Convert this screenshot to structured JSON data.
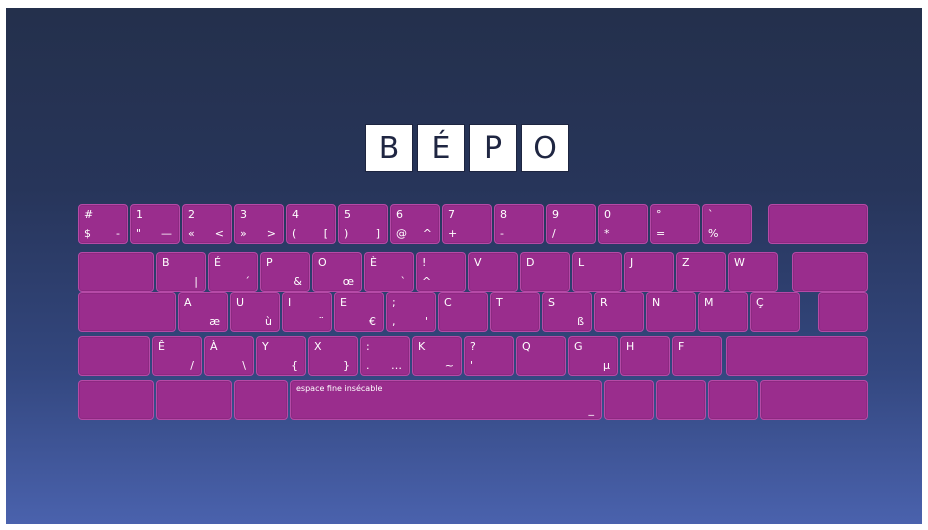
{
  "logo": {
    "letters": [
      "B",
      "É",
      "P",
      "O"
    ]
  },
  "rows": [
    [
      {
        "tl": "#",
        "bl": "$",
        "br": "-"
      },
      {
        "tl": "1",
        "bl": "\"",
        "br": "—"
      },
      {
        "tl": "2",
        "bl": "«",
        "br": "<"
      },
      {
        "tl": "3",
        "bl": "»",
        "br": ">"
      },
      {
        "tl": "4",
        "bl": "(",
        "br": "["
      },
      {
        "tl": "5",
        "bl": ")",
        "br": "]"
      },
      {
        "tl": "6",
        "bl": "@",
        "br": "^"
      },
      {
        "tl": "7",
        "bl": "+"
      },
      {
        "tl": "8",
        "bl": "-"
      },
      {
        "tl": "9",
        "bl": "/"
      },
      {
        "tl": "0",
        "bl": "*"
      },
      {
        "tl": "°",
        "bl": "="
      },
      {
        "tl": "`",
        "bl": "%"
      },
      {}
    ],
    [
      {},
      {
        "tl": "B",
        "br": "|"
      },
      {
        "tl": "É",
        "br": "´"
      },
      {
        "tl": "P",
        "br": "&"
      },
      {
        "tl": "O",
        "br": "œ"
      },
      {
        "tl": "È",
        "br": "`"
      },
      {
        "tl": "!",
        "bl": "^"
      },
      {
        "tl": "V"
      },
      {
        "tl": "D"
      },
      {
        "tl": "L"
      },
      {
        "tl": "J"
      },
      {
        "tl": "Z"
      },
      {
        "tl": "W"
      },
      {}
    ],
    [
      {},
      {
        "tl": "A",
        "br": "æ"
      },
      {
        "tl": "U",
        "br": "ù"
      },
      {
        "tl": "I",
        "br": "¨"
      },
      {
        "tl": "E",
        "br": "€"
      },
      {
        "tl": ";",
        "bl": ",",
        "br": "'"
      },
      {
        "tl": "C"
      },
      {
        "tl": "T"
      },
      {
        "tl": "S",
        "br": "ß"
      },
      {
        "tl": "R"
      },
      {
        "tl": "N"
      },
      {
        "tl": "M"
      },
      {
        "tl": "Ç"
      },
      {}
    ],
    [
      {},
      {
        "tl": "Ê",
        "br": "/"
      },
      {
        "tl": "À",
        "br": "\\"
      },
      {
        "tl": "Y",
        "br": "{"
      },
      {
        "tl": "X",
        "br": "}"
      },
      {
        "tl": ":",
        "bl": ".",
        "br": "…"
      },
      {
        "tl": "K",
        "br": "~"
      },
      {
        "tl": "?",
        "bl": "'"
      },
      {
        "tl": "Q"
      },
      {
        "tl": "G",
        "br": "µ"
      },
      {
        "tl": "H"
      },
      {
        "tl": "F"
      },
      {}
    ],
    [
      {},
      {},
      {},
      {
        "tl": "espace fine insécable",
        "br": "_"
      },
      {},
      {},
      {},
      {}
    ]
  ]
}
